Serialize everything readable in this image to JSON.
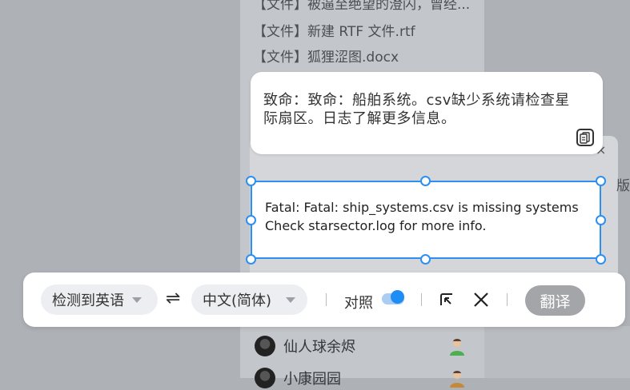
{
  "background": {
    "files": [
      "【文件】被逼至绝望的澄闪，曾经...",
      "【文件】新建 RTF 文件.rtf",
      "【文件】狐狸涩图.docx"
    ],
    "contacts": [
      {
        "name": "仙人球余烬"
      },
      {
        "name": "小康园园"
      }
    ],
    "right_fragment": "版",
    "close_glyph": "×"
  },
  "translation": {
    "result_text": "致命：致命：船舶系统。csv缺少系统请检查星际扇区。日志了解更多信息。",
    "source_text": "Fatal: Fatal: ship_systems.csv is missing systems Check starsector.log for more info."
  },
  "toolbar": {
    "source_lang": "检测到英语",
    "target_lang": "中文(简体)",
    "compare_label": "对照",
    "compare_on": true,
    "translate_label": "翻译"
  },
  "colors": {
    "accent": "#2d8ff0",
    "toggle_on": "#1e8ef5",
    "translate_button": "#a3a5a8"
  }
}
